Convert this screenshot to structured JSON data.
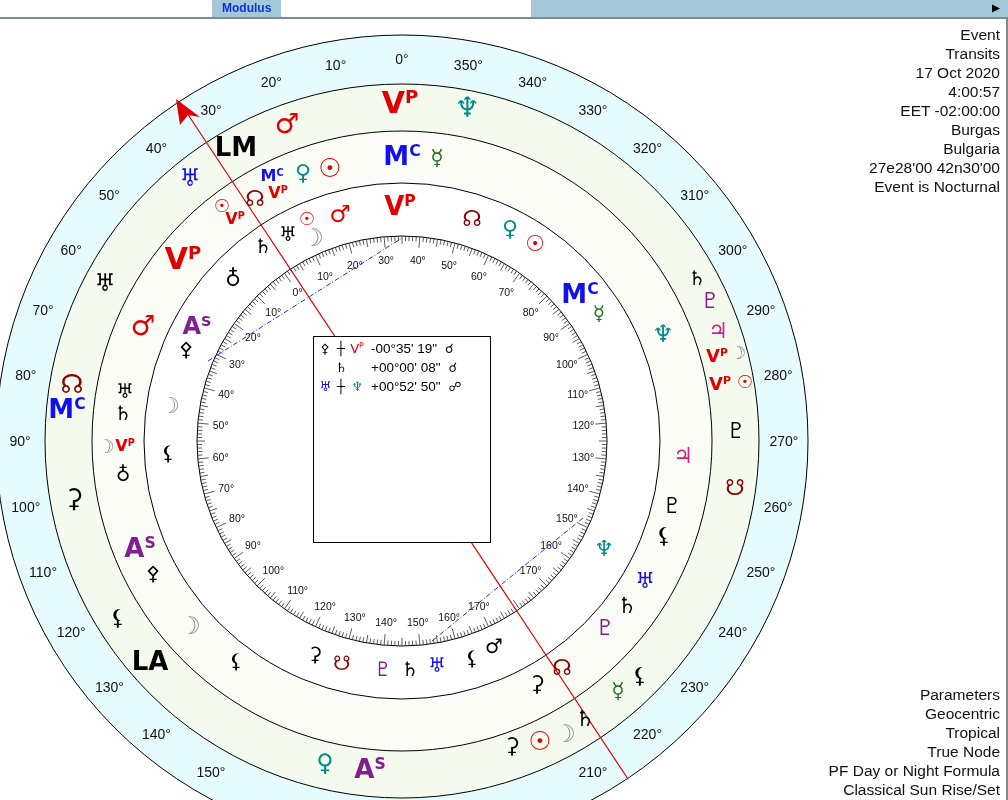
{
  "toolbar": {
    "label": "Modulus"
  },
  "chart": {
    "outer_scale_ccw": [
      "0°",
      "10°",
      "20°",
      "30°",
      "40°",
      "50°",
      "60°",
      "70°",
      "80°",
      "90°",
      "100°",
      "110°",
      "120°",
      "130°",
      "140°",
      "150°"
    ],
    "outer_scale_cw": [
      "350°",
      "340°",
      "330°",
      "320°",
      "310°",
      "300°",
      "290°",
      "280°",
      "270°",
      "260°",
      "250°",
      "240°",
      "230°",
      "220°",
      "210°"
    ],
    "dial_zero": "0°",
    "dial_cw": [
      "10°",
      "20°",
      "30°",
      "40°",
      "50°",
      "60°",
      "70°",
      "80°",
      "90°",
      "100°",
      "110°",
      "120°",
      "130°",
      "140°",
      "150°",
      "160°",
      "170°"
    ],
    "dial_ccw": [
      "10°",
      "20°",
      "30°",
      "40°",
      "50°",
      "60°",
      "70°",
      "80°",
      "90°",
      "100°",
      "110°",
      "120°",
      "130°",
      "140°",
      "150°",
      "160°",
      "170°"
    ],
    "glyphs": [
      {
        "symbol": "V$^{P}$",
        "color": "#e00000"
      },
      {
        "symbol": "♆",
        "color": "#008b8b"
      },
      {
        "symbol": "♂",
        "color": "#e00000"
      },
      {
        "symbol": "LM",
        "color": "#000000"
      },
      {
        "symbol": "♅",
        "color": "#1010f0"
      },
      {
        "symbol": "V$^{P}$",
        "color": "#e00000"
      },
      {
        "symbol": "♅",
        "color": "#000000"
      },
      {
        "symbol": "♂",
        "color": "#e00000"
      },
      {
        "symbol": "☊",
        "color": "#8b0000"
      },
      {
        "symbol": "M$^{C}$",
        "color": "#1010f0"
      },
      {
        "symbol": "⚳",
        "color": "#000000"
      },
      {
        "symbol": "A$^{S}$",
        "color": "#802090"
      },
      {
        "symbol": "⚴",
        "color": "#000000"
      },
      {
        "symbol": "⚸",
        "color": "#000000"
      },
      {
        "symbol": "☽",
        "color": "#909090"
      },
      {
        "symbol": "LA",
        "color": "#000000"
      },
      {
        "symbol": "♀",
        "color": "#008b8b"
      },
      {
        "symbol": "A$^{S}$",
        "color": "#802090"
      },
      {
        "symbol": "⚳",
        "color": "#000000"
      },
      {
        "symbol": "☉",
        "color": "#e00000"
      },
      {
        "symbol": "☽",
        "color": "#909090"
      },
      {
        "symbol": "♄",
        "color": "#000000"
      },
      {
        "symbol": "⚳",
        "color": "#000000"
      },
      {
        "symbol": "☊",
        "color": "#8b0000"
      },
      {
        "symbol": "☿",
        "color": "#207020"
      },
      {
        "symbol": "⚸",
        "color": "#000000"
      },
      {
        "symbol": "♇",
        "color": "#8b1a8b"
      },
      {
        "symbol": "♄",
        "color": "#000000"
      },
      {
        "symbol": "♅",
        "color": "#1010f0"
      },
      {
        "symbol": "♆",
        "color": "#008b8b"
      },
      {
        "symbol": "⚸",
        "color": "#000000"
      },
      {
        "symbol": "♇",
        "color": "#000000"
      },
      {
        "symbol": "☋",
        "color": "#8b0000"
      },
      {
        "symbol": "♃",
        "color": "#d0208a"
      },
      {
        "symbol": "♇",
        "color": "#000000"
      },
      {
        "symbol": "V$^{P}$",
        "color": "#e00000"
      },
      {
        "symbol": "☉",
        "color": "#e00000"
      },
      {
        "symbol": "V$^{P}$",
        "color": "#e00000"
      },
      {
        "symbol": "☽",
        "color": "#909090"
      },
      {
        "symbol": "♃",
        "color": "#d0208a"
      },
      {
        "symbol": "♇",
        "color": "#8b1a8b"
      },
      {
        "symbol": "♄",
        "color": "#000000"
      },
      {
        "symbol": "♆",
        "color": "#008b8b"
      },
      {
        "symbol": "M$^{C}$",
        "color": "#1010f0"
      },
      {
        "symbol": "☿",
        "color": "#207020"
      },
      {
        "symbol": "M$^{C}$",
        "color": "#1010f0"
      },
      {
        "symbol": "☿",
        "color": "#207020"
      },
      {
        "symbol": "M$^{C}$",
        "color": "#1010f0"
      },
      {
        "symbol": "♀",
        "color": "#008b8b"
      },
      {
        "symbol": "☉",
        "color": "#e00000"
      },
      {
        "symbol": "V$^{P}$",
        "color": "#e00000"
      },
      {
        "symbol": "☊",
        "color": "#8b0000"
      },
      {
        "symbol": "☉",
        "color": "#e00000"
      },
      {
        "symbol": "V$^{P}$",
        "color": "#e00000"
      },
      {
        "symbol": "V$^{P}$",
        "color": "#e00000"
      },
      {
        "symbol": "☊",
        "color": "#8b0000"
      },
      {
        "symbol": "♀",
        "color": "#008b8b"
      },
      {
        "symbol": "☉",
        "color": "#e00000"
      },
      {
        "symbol": "☉",
        "color": "#e00000"
      },
      {
        "symbol": "♂",
        "color": "#e00000"
      },
      {
        "symbol": "♅",
        "color": "#000000"
      },
      {
        "symbol": "☽",
        "color": "#909090"
      },
      {
        "symbol": "♄",
        "color": "#000000"
      },
      {
        "symbol": "♁",
        "color": "#000000"
      },
      {
        "symbol": "A$^{S}$",
        "color": "#802090"
      },
      {
        "symbol": "⚴",
        "color": "#000000"
      },
      {
        "symbol": "♅",
        "color": "#000000"
      },
      {
        "symbol": "♄",
        "color": "#000000"
      },
      {
        "symbol": "☽",
        "color": "#909090"
      },
      {
        "symbol": "☽",
        "color": "#909090"
      },
      {
        "symbol": "V$^{P}$",
        "color": "#e00000"
      },
      {
        "symbol": "♁",
        "color": "#000000"
      },
      {
        "symbol": "⚸",
        "color": "#000000"
      },
      {
        "symbol": "⚸",
        "color": "#000000"
      },
      {
        "symbol": "⚳",
        "color": "#000000"
      },
      {
        "symbol": "☋",
        "color": "#8b0000"
      },
      {
        "symbol": "♇",
        "color": "#8b1a8b"
      },
      {
        "symbol": "♄",
        "color": "#000000"
      },
      {
        "symbol": "♅",
        "color": "#1010f0"
      },
      {
        "symbol": "⚸",
        "color": "#000000"
      },
      {
        "symbol": "♂",
        "color": "#000000"
      }
    ]
  },
  "aspects": [
    {
      "column_1": {
        "symbol": "⚴",
        "color": "#000000"
      },
      "column_2": {
        "symbol": "┼",
        "color": "#000000"
      },
      "column_3": {
        "symbol": "V$^{P}$",
        "color": "#e00000"
      },
      "value": "-00°35' 19\"",
      "aspect": "☌"
    },
    {
      "column_2": {
        "symbol": "♄",
        "color": "#000000"
      },
      "value": "+00°00' 08\"",
      "aspect": "☌"
    },
    {
      "column_1": {
        "symbol": "♅",
        "color": "#1010f0"
      },
      "column_2": {
        "symbol": "┼",
        "color": "#000000"
      },
      "column_3": {
        "symbol": "♆",
        "color": "#008b8b"
      },
      "value": "+00°52' 50\"",
      "aspect": "☍"
    }
  ],
  "event_info": [
    "Event",
    "Transits",
    "17 Oct 2020",
    "4:00:57",
    "EET -02:00:00",
    "Burgas",
    "Bulgaria",
    "27e28'00 42n30'00",
    "Event is Nocturnal"
  ],
  "parameters": [
    "Parameters",
    "Geocentric",
    "Tropical",
    "True Node",
    "PF Day or Night Formula",
    "Classical Sun Rise/Set"
  ]
}
